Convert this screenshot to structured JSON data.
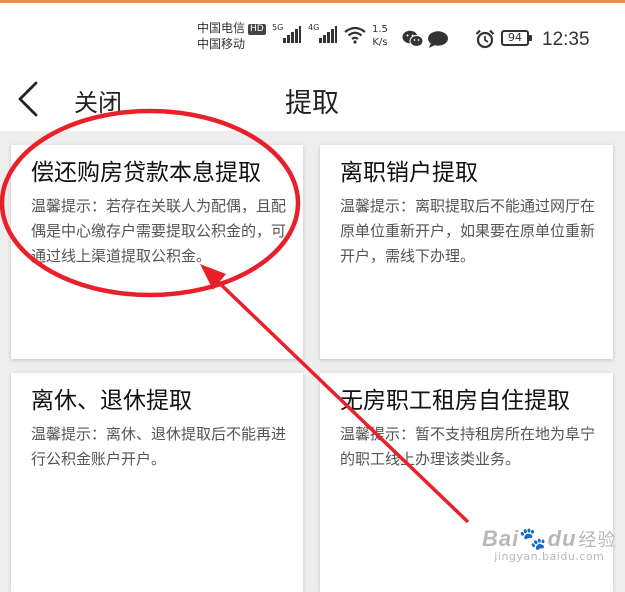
{
  "status_bar": {
    "carrier_1": "中国电信",
    "hd_badge": "HD",
    "carrier_2": "中国移动",
    "network_1": "5G",
    "network_2": "4G",
    "speed_value": "1.5",
    "speed_unit": "K/s",
    "battery": "94",
    "time": "12:35",
    "icons": [
      "signal-5g-icon",
      "signal-4g-icon",
      "wifi-icon",
      "wechat-icon",
      "chat-bubble-icon",
      "alarm-icon",
      "battery-icon"
    ]
  },
  "header": {
    "back_icon": "chevron-left-icon",
    "close_label": "关闭",
    "title": "提取"
  },
  "cards": [
    {
      "title": "偿还购房贷款本息提取",
      "desc": "温馨提示：若存在关联人为配偶，且配偶是中心缴存户需要提取公积金的，可通过线上渠道提取公积金。"
    },
    {
      "title": "离职销户提取",
      "desc": "温馨提示：离职提取后不能通过网厅在原单位重新开户，如果要在原单位重新开户，需线下办理。"
    },
    {
      "title": "离休、退休提取",
      "desc": "温馨提示：离休、退休提取后不能再进行公积金账户开户。"
    },
    {
      "title": "无房职工租房自住提取",
      "desc": "温馨提示：暂不支持租房所在地为阜宁的职工线上办理该类业务。"
    }
  ],
  "annotation": {
    "highlight_color": "#e8202a",
    "watermark_main": "Bai",
    "watermark_tail": "du",
    "watermark_cn": "经验",
    "watermark_sub": "jingyan.baidu.com"
  }
}
